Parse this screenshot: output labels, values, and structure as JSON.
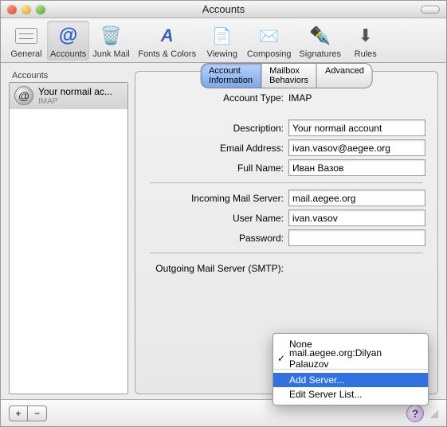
{
  "window": {
    "title": "Accounts"
  },
  "toolbar": {
    "items": [
      {
        "label": "General",
        "icon": "slider-icon"
      },
      {
        "label": "Accounts",
        "icon": "at-icon"
      },
      {
        "label": "Junk Mail",
        "icon": "junk-icon"
      },
      {
        "label": "Fonts & Colors",
        "icon": "fonts-icon"
      },
      {
        "label": "Viewing",
        "icon": "viewing-icon"
      },
      {
        "label": "Composing",
        "icon": "composing-icon"
      },
      {
        "label": "Signatures",
        "icon": "signatures-icon"
      },
      {
        "label": "Rules",
        "icon": "rules-icon"
      }
    ]
  },
  "sidebar": {
    "header": "Accounts",
    "accounts": [
      {
        "name": "Your normail ac...",
        "type": "IMAP"
      }
    ]
  },
  "tabs": {
    "account_info": "Account Information",
    "mailbox_behaviors": "Mailbox Behaviors",
    "advanced": "Advanced"
  },
  "form": {
    "account_type_label": "Account Type:",
    "account_type_value": "IMAP",
    "description_label": "Description:",
    "description_value": "Your normail account",
    "email_label": "Email Address:",
    "email_value": "ivan.vasov@aegee.org",
    "fullname_label": "Full Name:",
    "fullname_value": "Иван Вазов",
    "incoming_label": "Incoming Mail Server:",
    "incoming_value": "mail.aegee.org",
    "username_label": "User Name:",
    "username_value": "ivan.vasov",
    "password_label": "Password:",
    "password_value": "",
    "smtp_label": "Outgoing Mail Server (SMTP):"
  },
  "smtp_menu": {
    "none": "None",
    "selected": "mail.aegee.org:Dilyan Palauzov",
    "add": "Add Server...",
    "edit": "Edit Server List..."
  },
  "footer": {
    "add": "+",
    "remove": "−",
    "help": "?"
  }
}
